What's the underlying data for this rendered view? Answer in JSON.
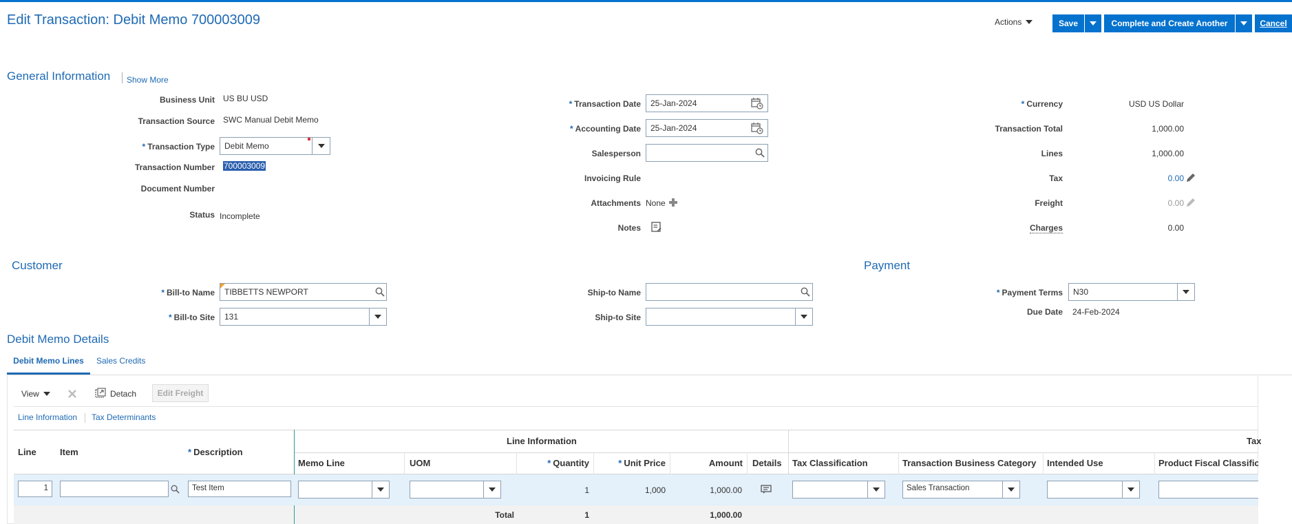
{
  "header": {
    "title": "Edit Transaction: Debit Memo 700003009",
    "actions_label": "Actions",
    "save_label": "Save",
    "complete_label": "Complete and Create Another",
    "cancel_label": "Cancel"
  },
  "general": {
    "title": "General Information",
    "show_more": "Show More",
    "business_unit_label": "Business Unit",
    "business_unit": "US BU USD",
    "source_label": "Transaction Source",
    "source": "SWC Manual Debit Memo",
    "type_label": "Transaction Type",
    "type": "Debit Memo",
    "number_label": "Transaction Number",
    "number": "700003009",
    "document_label": "Document Number",
    "status_label": "Status",
    "status": "Incomplete",
    "trx_date_label": "Transaction Date",
    "trx_date": "25-Jan-2024",
    "acct_date_label": "Accounting Date",
    "acct_date": "25-Jan-2024",
    "salesperson_label": "Salesperson",
    "invoicing_rule_label": "Invoicing Rule",
    "attachments_label": "Attachments",
    "attachments": "None",
    "notes_label": "Notes",
    "currency_label": "Currency",
    "currency": "USD US Dollar",
    "total_label": "Transaction Total",
    "total": "1,000.00",
    "lines_label": "Lines",
    "lines": "1,000.00",
    "tax_label": "Tax",
    "tax": "0.00",
    "freight_label": "Freight",
    "freight": "0.00",
    "charges_label": "Charges",
    "charges": "0.00"
  },
  "customer": {
    "title": "Customer",
    "bill_to_name_label": "Bill-to Name",
    "bill_to_name": "TIBBETTS NEWPORT",
    "bill_to_site_label": "Bill-to Site",
    "bill_to_site": "131",
    "ship_to_name_label": "Ship-to Name",
    "ship_to_site_label": "Ship-to Site"
  },
  "payment": {
    "title": "Payment",
    "terms_label": "Payment Terms",
    "terms": "N30",
    "due_date_label": "Due Date",
    "due_date": "24-Feb-2024"
  },
  "details": {
    "title": "Debit Memo Details",
    "tabs": [
      "Debit Memo Lines",
      "Sales Credits"
    ],
    "toolbar": {
      "view": "View",
      "detach": "Detach",
      "edit_freight": "Edit Freight"
    },
    "subtabs": [
      "Line Information",
      "Tax Determinants"
    ],
    "group_headers": {
      "line_info": "Line Information",
      "tax": "Tax"
    },
    "columns": {
      "line": "Line",
      "item": "Item",
      "description": "Description",
      "memo_line": "Memo Line",
      "uom": "UOM",
      "quantity": "Quantity",
      "unit_price": "Unit Price",
      "amount": "Amount",
      "details": "Details",
      "tax_class": "Tax Classification",
      "tbc": "Transaction Business Category",
      "intended_use": "Intended Use",
      "pfc": "Product Fiscal Classific"
    },
    "row": {
      "line": "1",
      "item": "",
      "description": "Test Item",
      "quantity": "1",
      "unit_price": "1,000",
      "amount": "1,000.00",
      "tbc": "Sales Transaction"
    },
    "totals": {
      "label": "Total",
      "quantity": "1",
      "amount": "1,000.00"
    }
  }
}
